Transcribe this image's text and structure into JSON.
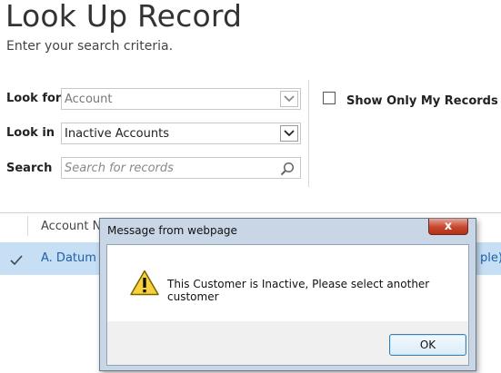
{
  "page": {
    "title": "Look Up Record",
    "subtitle": "Enter your search criteria."
  },
  "form": {
    "look_for": {
      "label": "Look for",
      "value": "Account"
    },
    "look_in": {
      "label": "Look in",
      "value": "Inactive Accounts"
    },
    "search": {
      "label": "Search",
      "placeholder": "Search for records"
    },
    "show_only_mine": {
      "label": "Show Only My Records",
      "checked": false
    }
  },
  "grid": {
    "header": "Account N",
    "rows": [
      {
        "name": "A. Datum C",
        "right_fragment": "ple)"
      }
    ]
  },
  "dialog": {
    "title": "Message from webpage",
    "message": "This Customer is Inactive, Please select another customer",
    "ok_label": "OK",
    "close_glyph": "x"
  },
  "colors": {
    "row_selected": "#c7dff5",
    "link": "#1f5fa8",
    "close_button": "#c6452d"
  }
}
